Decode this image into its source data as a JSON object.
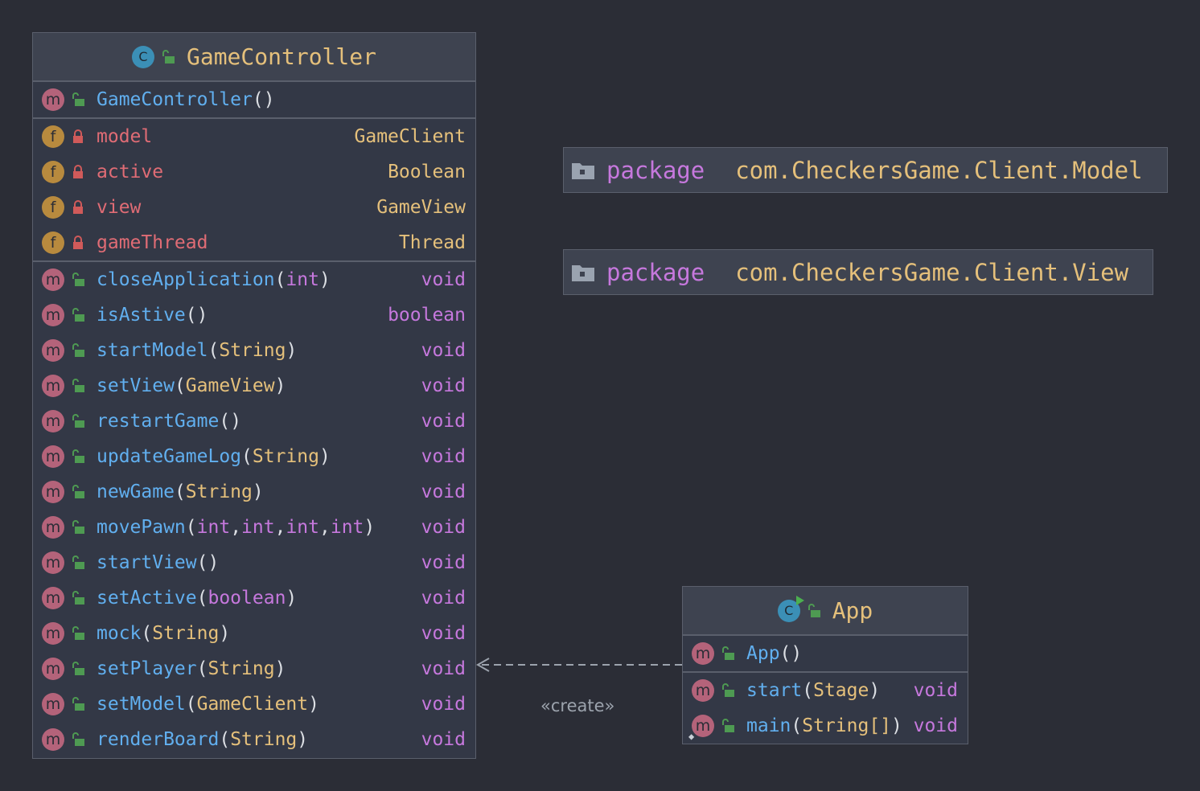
{
  "game_controller": {
    "title": "GameController",
    "constructor": {
      "name": "GameController",
      "params": []
    },
    "fields": [
      {
        "name": "model",
        "type": "GameClient",
        "type_kind": "class"
      },
      {
        "name": "active",
        "type": "Boolean",
        "type_kind": "class"
      },
      {
        "name": "view",
        "type": "GameView",
        "type_kind": "class"
      },
      {
        "name": "gameThread",
        "type": "Thread",
        "type_kind": "class"
      }
    ],
    "methods": [
      {
        "name": "closeApplication",
        "params": [
          {
            "t": "int",
            "kind": "prim"
          }
        ],
        "ret": "void",
        "ret_kind": "prim"
      },
      {
        "name": "isAstive",
        "params": [],
        "ret": "boolean",
        "ret_kind": "prim"
      },
      {
        "name": "startModel",
        "params": [
          {
            "t": "String",
            "kind": "class"
          }
        ],
        "ret": "void",
        "ret_kind": "prim"
      },
      {
        "name": "setView",
        "params": [
          {
            "t": "GameView",
            "kind": "class"
          }
        ],
        "ret": "void",
        "ret_kind": "prim"
      },
      {
        "name": "restartGame",
        "params": [],
        "ret": "void",
        "ret_kind": "prim"
      },
      {
        "name": "updateGameLog",
        "params": [
          {
            "t": "String",
            "kind": "class"
          }
        ],
        "ret": "void",
        "ret_kind": "prim"
      },
      {
        "name": "newGame",
        "params": [
          {
            "t": "String",
            "kind": "class"
          }
        ],
        "ret": "void",
        "ret_kind": "prim"
      },
      {
        "name": "movePawn",
        "params": [
          {
            "t": "int",
            "kind": "prim"
          },
          {
            "t": "int",
            "kind": "prim"
          },
          {
            "t": "int",
            "kind": "prim"
          },
          {
            "t": "int",
            "kind": "prim"
          }
        ],
        "ret": "void",
        "ret_kind": "prim"
      },
      {
        "name": "startView",
        "params": [],
        "ret": "void",
        "ret_kind": "prim"
      },
      {
        "name": "setActive",
        "params": [
          {
            "t": "boolean",
            "kind": "prim"
          }
        ],
        "ret": "void",
        "ret_kind": "prim"
      },
      {
        "name": "mock",
        "params": [
          {
            "t": "String",
            "kind": "class"
          }
        ],
        "ret": "void",
        "ret_kind": "prim"
      },
      {
        "name": "setPlayer",
        "params": [
          {
            "t": "String",
            "kind": "class"
          }
        ],
        "ret": "void",
        "ret_kind": "prim"
      },
      {
        "name": "setModel",
        "params": [
          {
            "t": "GameClient",
            "kind": "class"
          }
        ],
        "ret": "void",
        "ret_kind": "prim"
      },
      {
        "name": "renderBoard",
        "params": [
          {
            "t": "String",
            "kind": "class"
          }
        ],
        "ret": "void",
        "ret_kind": "prim"
      }
    ]
  },
  "app": {
    "title": "App",
    "constructor": {
      "name": "App",
      "params": []
    },
    "methods": [
      {
        "name": "start",
        "params": [
          {
            "t": "Stage",
            "kind": "class"
          }
        ],
        "ret": "void",
        "ret_kind": "prim",
        "static": false
      },
      {
        "name": "main",
        "params": [
          {
            "t": "String[]",
            "kind": "class"
          }
        ],
        "ret": "void",
        "ret_kind": "prim",
        "static": true
      }
    ]
  },
  "packages": [
    {
      "keyword": "package",
      "name": "com.CheckersGame.Client.Model"
    },
    {
      "keyword": "package",
      "name": "com.CheckersGame.Client.View"
    }
  ],
  "relation": {
    "label": "«create»",
    "from": "App",
    "to": "GameController",
    "style": "dashed"
  },
  "colors": {
    "background": "#2b2d36",
    "box": "#333846",
    "header": "#3e4350",
    "border": "#5a5f6c",
    "class_type": "#e5c07b",
    "primitive": "#c678dd",
    "method": "#61afef",
    "field": "#e06c75",
    "method_badge": "#b4637a",
    "field_badge": "#b88a3e",
    "class_badge": "#3b8fb6",
    "public_icon": "#4e9a52",
    "private_icon": "#d05a5a"
  }
}
